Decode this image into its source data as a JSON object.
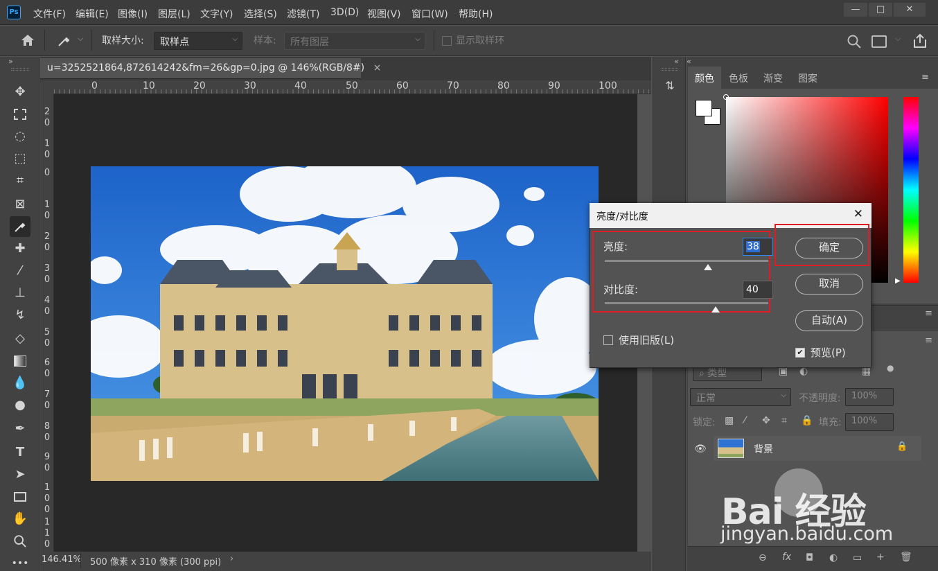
{
  "menubar": {
    "logo": "Ps",
    "items": [
      "文件(F)",
      "编辑(E)",
      "图像(I)",
      "图层(L)",
      "文字(Y)",
      "选择(S)",
      "滤镜(T)",
      "3D(D)",
      "视图(V)",
      "窗口(W)",
      "帮助(H)"
    ],
    "min_label": "—",
    "max_label": "□",
    "close_label": "✕"
  },
  "options": {
    "sample_size_label": "取样大小:",
    "sample_size_value": "取样点",
    "sample_label": "样本:",
    "sample_value": "所有图层",
    "show_ring_label": "显示取样环"
  },
  "document": {
    "tab_title": "u=3252521864,872614242&fm=26&gp=0.jpg @ 146%(RGB/8#)",
    "tab_close": "×",
    "ruler_h": [
      "0",
      "10",
      "20",
      "30",
      "40",
      "50",
      "60",
      "70",
      "80",
      "90",
      "100"
    ],
    "ruler_v": [
      "2\n0",
      "1\n0",
      "0",
      "1\n0",
      "2\n0",
      "3\n0",
      "4\n0",
      "5\n0",
      "6\n0",
      "7\n0",
      "8\n0",
      "9\n0",
      "1\n0\n0",
      "1\n1\n0"
    ],
    "zoom": "146.41%",
    "doc_info": "500 像素 x 310 像素 (300 ppi)",
    "status_arrow": "›"
  },
  "dialog": {
    "title": "亮度/对比度",
    "close": "✕",
    "brightness_label": "亮度:",
    "brightness_value": "38",
    "contrast_label": "对比度:",
    "contrast_value": "40",
    "ok_label": "确定",
    "cancel_label": "取消",
    "auto_label": "自动(A)",
    "legacy_label": "使用旧版(L)",
    "preview_label": "预览(P)",
    "brightness_level": 0.63,
    "contrast_level": 0.68
  },
  "panels": {
    "color_tabs": [
      "颜色",
      "色板",
      "渐变",
      "图案"
    ],
    "layers": {
      "filter_kind": "类型",
      "blend_mode": "正常",
      "opacity_label": "不透明度:",
      "opacity_value": "100%",
      "lock_label": "锁定:",
      "fill_label": "填充:",
      "fill_value": "100%",
      "layer_name": "背景",
      "bottom_icons": [
        "⊖",
        "fx",
        "◘",
        "◐",
        "▭",
        "+",
        "🗑"
      ]
    }
  },
  "watermark": {
    "brand": "Bai 经验",
    "url": "jingyan.baidu.com"
  }
}
